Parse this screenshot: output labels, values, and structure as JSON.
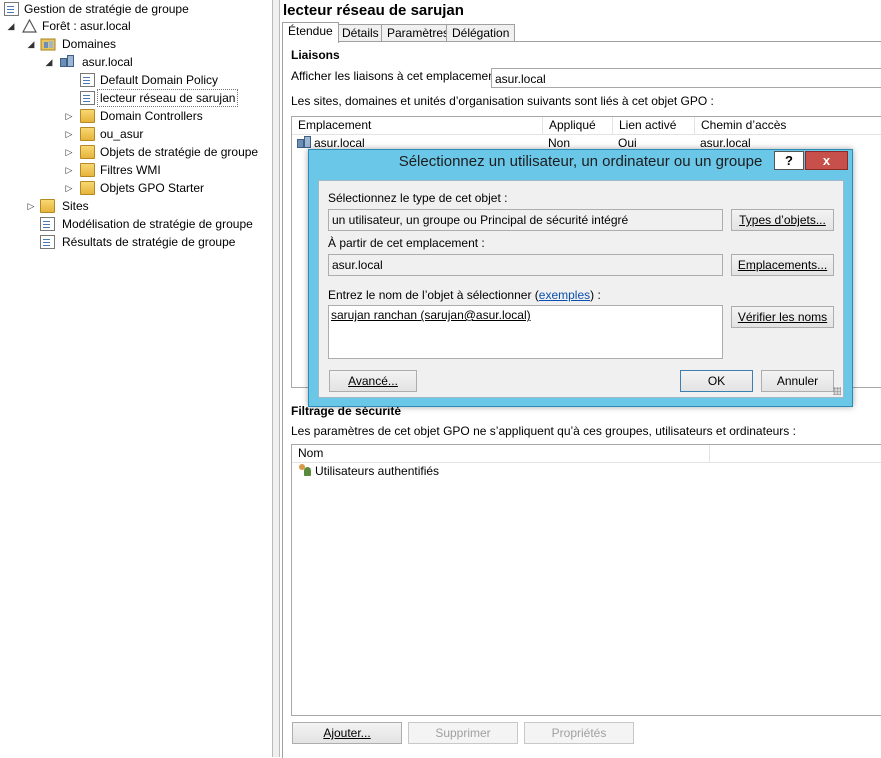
{
  "tree": {
    "root": "Gestion de stratégie de groupe",
    "forest": "Forêt : asur.local",
    "domains": "Domaines",
    "domain": "asur.local",
    "items": [
      "Default Domain Policy",
      "lecteur réseau de sarujan",
      "Domain Controllers",
      "ou_asur",
      "Objets de stratégie de groupe",
      "Filtres WMI",
      "Objets GPO Starter"
    ],
    "sites": "Sites",
    "modeling": "Modélisation de stratégie de groupe",
    "results": "Résultats de stratégie de groupe"
  },
  "gpo": {
    "title": "lecteur réseau de sarujan",
    "tabs": [
      "Étendue",
      "Détails",
      "Paramètres",
      "Délégation"
    ],
    "links": {
      "section": "Liaisons",
      "show_label": "Afficher les liaisons à cet emplacement :",
      "show_value": "asur.local",
      "desc": "Les sites, domaines et unités d’organisation suivants sont liés à cet objet GPO :",
      "columns": [
        "Emplacement",
        "Appliqué",
        "Lien activé",
        "Chemin d’accès"
      ],
      "rows": [
        {
          "location": "asur.local",
          "enforced": "Non",
          "enabled": "Oui",
          "path": "asur.local"
        }
      ]
    },
    "security": {
      "section": "Filtrage de sécurité",
      "desc": "Les paramètres de cet objet GPO ne s’appliquent qu’à ces groupes, utilisateurs et ordinateurs :",
      "column": "Nom",
      "rows": [
        "Utilisateurs authentifiés"
      ],
      "buttons": {
        "add": "Ajouter...",
        "remove": "Supprimer",
        "props": "Propriétés"
      }
    }
  },
  "dialog": {
    "title": "Sélectionnez un utilisateur, un ordinateur ou un groupe",
    "help": "?",
    "close": "x",
    "type_label": "Sélectionnez le type de cet objet :",
    "type_value": "un utilisateur, un groupe ou Principal de sécurité intégré",
    "type_button": "Types d’objets...",
    "loc_label": "À partir de cet emplacement :",
    "loc_value": "asur.local",
    "loc_button": "Emplacements...",
    "name_label_prefix": "Entrez le nom de l’objet à sélectionner (",
    "name_label_link": "exemples",
    "name_label_suffix": ") :",
    "name_value": "sarujan ranchan (sarujan@asur.local)",
    "check_button": "Vérifier les noms",
    "advanced_button": "Avancé...",
    "ok_button": "OK",
    "cancel_button": "Annuler"
  }
}
